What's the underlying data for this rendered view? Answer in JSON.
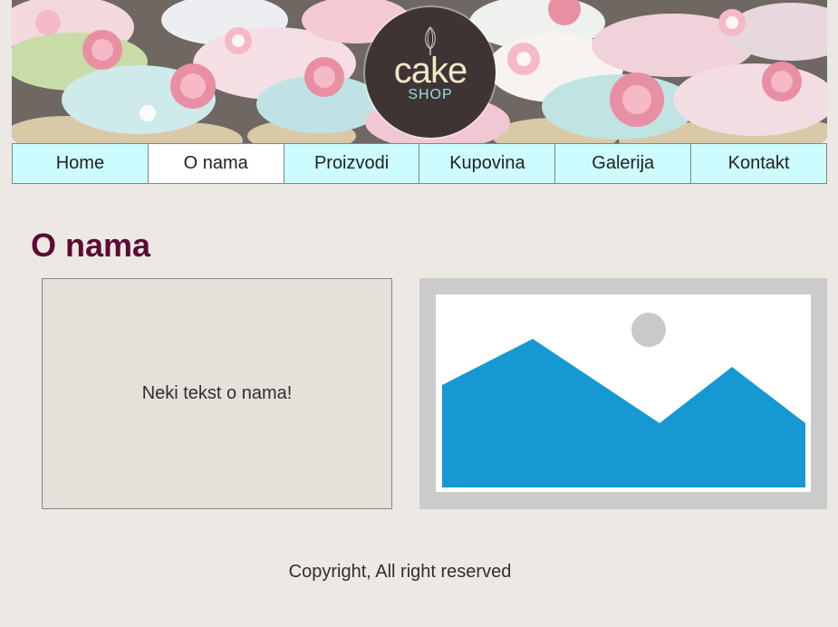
{
  "header": {
    "logo": {
      "word": "cake",
      "subword": "SHOP"
    }
  },
  "nav": {
    "items": [
      {
        "label": "Home"
      },
      {
        "label": "O nama"
      },
      {
        "label": "Proizvodi"
      },
      {
        "label": "Kupovina"
      },
      {
        "label": "Galerija"
      },
      {
        "label": "Kontakt"
      }
    ],
    "active_index": 1
  },
  "main": {
    "title": "O nama",
    "about_text": "Neki tekst o nama!"
  },
  "footer": {
    "text": "Copyright, All right reserved"
  },
  "colors": {
    "background": "#ece9e4",
    "nav_background": "#ccfcfd",
    "nav_active": "#ffffff",
    "title": "#5c0a32",
    "placeholder_blue": "#1699d2",
    "placeholder_frame": "#cbcbcb"
  }
}
